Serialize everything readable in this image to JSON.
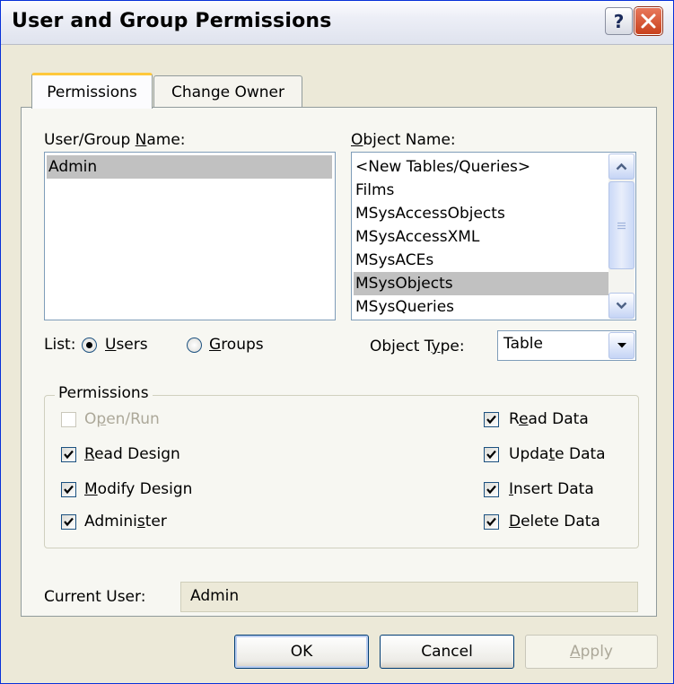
{
  "window": {
    "title": "User and Group Permissions"
  },
  "tabs": [
    {
      "label": "Permissions",
      "active": true
    },
    {
      "label": "Change Owner",
      "active": false
    }
  ],
  "user_group": {
    "label_pre": "User/Group ",
    "label_key": "N",
    "label_post": "ame:",
    "items": [
      "Admin"
    ],
    "selected": "Admin"
  },
  "object_name": {
    "label_key": "O",
    "label_post": "bject Name:",
    "items": [
      "<New Tables/Queries>",
      "Films",
      "MSysAccessObjects",
      "MSysAccessXML",
      "MSysACEs",
      "MSysObjects",
      "MSysQueries"
    ],
    "selected": "MSysObjects"
  },
  "list": {
    "label": "List:",
    "users_key": "U",
    "users_rest": "sers",
    "groups_key": "G",
    "groups_rest": "roups",
    "selected": "Users"
  },
  "object_type": {
    "label_pre": "Object T",
    "label_key": "y",
    "label_post": "pe:",
    "value": "Table"
  },
  "permissions": {
    "group_label": "Permissions",
    "left": [
      {
        "pre": "O",
        "key": "p",
        "post": "en/Run",
        "checked": false,
        "enabled": false
      },
      {
        "pre": "",
        "key": "R",
        "post": "ead Design",
        "checked": true,
        "enabled": true
      },
      {
        "pre": "",
        "key": "M",
        "post": "odify Design",
        "checked": true,
        "enabled": true
      },
      {
        "pre": "Admini",
        "key": "s",
        "post": "ter",
        "checked": true,
        "enabled": true
      }
    ],
    "right": [
      {
        "pre": "R",
        "key": "e",
        "post": "ad Data",
        "checked": true,
        "enabled": true
      },
      {
        "pre": "Upda",
        "key": "t",
        "post": "e Data",
        "checked": true,
        "enabled": true
      },
      {
        "pre": "",
        "key": "I",
        "post": "nsert Data",
        "checked": true,
        "enabled": true
      },
      {
        "pre": "",
        "key": "D",
        "post": "elete Data",
        "checked": true,
        "enabled": true
      }
    ]
  },
  "current_user": {
    "label": "Current User:",
    "value": "Admin"
  },
  "buttons": {
    "ok": "OK",
    "cancel": "Cancel",
    "apply_key": "A",
    "apply_rest": "pply"
  },
  "colors": {
    "selection": "#c1c1c1",
    "face": "#ece9d8",
    "close": "#c8401c"
  }
}
